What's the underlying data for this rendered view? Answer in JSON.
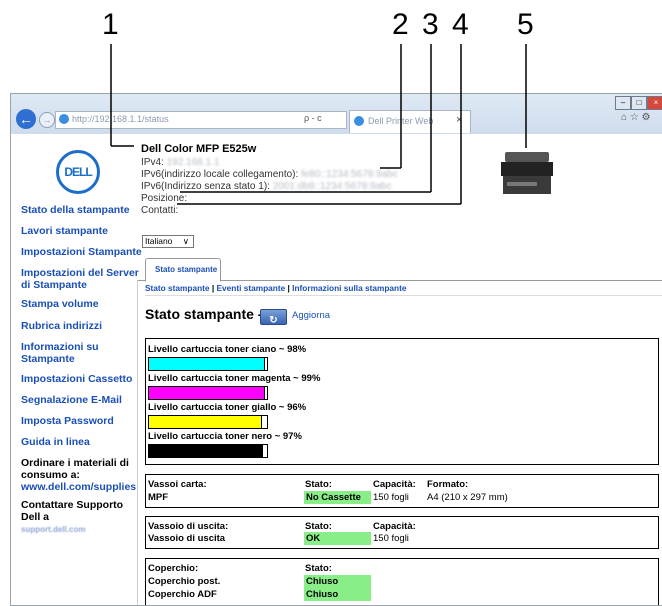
{
  "callouts": [
    "1",
    "2",
    "3",
    "4",
    "5"
  ],
  "browser": {
    "tab_title": "Dell Printer Web",
    "address_text": "http://192.168.1.1/status",
    "search_glyph": "ρ - c",
    "tab_close": "×",
    "toolbar_glyphs": "⌂ ☆ ⚙"
  },
  "logo": "DELL",
  "printer": {
    "name": "Dell Color MFP E525w",
    "ipv4_label": "IPv4:",
    "ipv4_value": "192.168.1.1",
    "ipv6_local_label": "IPv6(indirizzo locale collegamento):",
    "ipv6_local_value": "fe80::1234:5678:9abc",
    "ipv6_stateless_label": "IPv6(Indirizzo senza stato 1):",
    "ipv6_stateless_value": "2001:db8::1234:5678:9abc",
    "position_label": "Posizione:",
    "contacts_label": "Contatti:"
  },
  "sidebar": {
    "items": [
      "Stato della stampante",
      "Lavori stampante",
      "Impostazioni Stampante",
      "Impostazioni del Server di Stampante",
      "Stampa volume",
      "Rubrica indirizzi",
      "Informazioni su Stampante",
      "Impostazioni Cassetto",
      "Segnalazione E-Mail",
      "Imposta Password",
      "Guida in linea"
    ],
    "order_label": "Ordinare i materiali di consumo a:",
    "order_link": "www.dell.com/supplies",
    "support_label": "Contattare Supporto Dell a",
    "support_link": "support.dell.com"
  },
  "language": {
    "selected": "Italiano"
  },
  "tabs": {
    "active": "Stato stampante"
  },
  "subnav": {
    "items": [
      "Stato stampante",
      "Eventi stampante",
      "Informazioni sulla stampante"
    ],
    "separator": "|"
  },
  "page_title": "Stato stampante -",
  "refresh_label": "Aggiorna",
  "toner": [
    {
      "label": "Livello cartuccia toner ciano ~ 98%",
      "level": 98,
      "color": "#00ffff"
    },
    {
      "label": "Livello cartuccia toner magenta ~ 99%",
      "level": 99,
      "color": "#ff00ff"
    },
    {
      "label": "Livello cartuccia toner giallo ~ 96%",
      "level": 96,
      "color": "#ffff00"
    },
    {
      "label": "Livello cartuccia toner nero ~ 97%",
      "level": 97,
      "color": "#000000"
    }
  ],
  "trays": {
    "headers": {
      "name": "Vassoi carta:",
      "status": "Stato:",
      "capacity": "Capacità:",
      "format": "Formato:"
    },
    "row": {
      "name": "MPF",
      "status": "No Cassette",
      "capacity": "150 fogli",
      "format": "A4 (210 x 297 mm)"
    }
  },
  "output": {
    "headers": {
      "name": "Vassoio di uscita:",
      "status": "Stato:",
      "capacity": "Capacità:"
    },
    "row": {
      "name": "Vassoio di uscita",
      "status": "OK",
      "capacity": "150 fogli"
    }
  },
  "covers": {
    "headers": {
      "name": "Coperchio:",
      "status": "Stato:"
    },
    "rows": [
      {
        "name": "Coperchio post.",
        "status": "Chiuso"
      },
      {
        "name": "Coperchio ADF",
        "status": "Chiuso"
      }
    ]
  }
}
